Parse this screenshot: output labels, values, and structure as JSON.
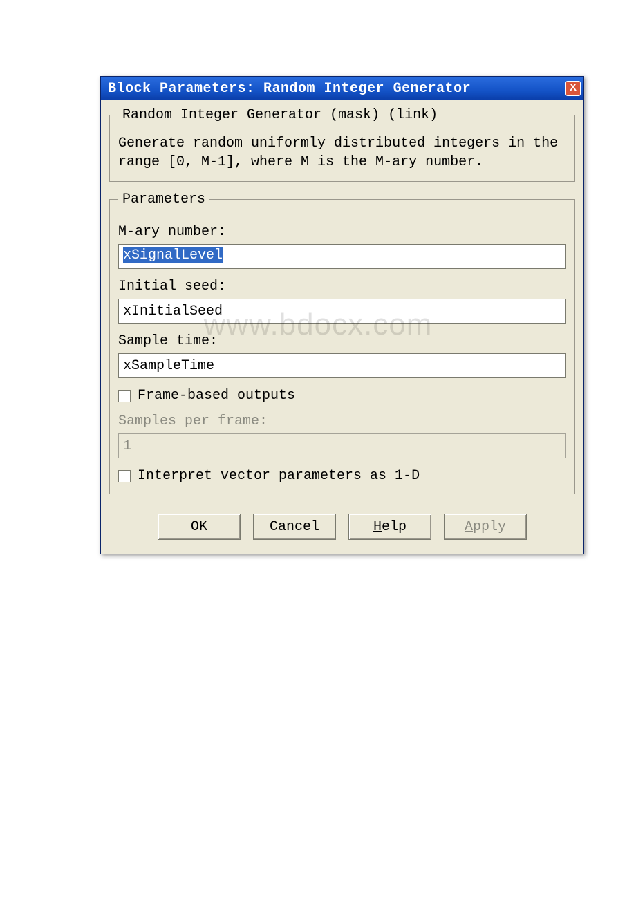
{
  "titlebar": {
    "title": "Block Parameters: Random Integer Generator",
    "close": "X"
  },
  "group_top": {
    "legend": "Random Integer Generator (mask) (link)",
    "description": "Generate random uniformly distributed integers in the range [0, M-1], where M is the M-ary number."
  },
  "params": {
    "legend": "Parameters",
    "mary_label": "M-ary number:",
    "mary_value": "xSignalLevel",
    "seed_label": "Initial seed:",
    "seed_value": "xInitialSeed",
    "sample_label": "Sample time:",
    "sample_value": "xSampleTime",
    "frame_based_label": "Frame-based outputs",
    "samples_per_frame_label": "Samples per frame:",
    "samples_per_frame_value": "1",
    "interpret_1d_label": "Interpret vector parameters as 1-D"
  },
  "buttons": {
    "ok": "OK",
    "cancel": "Cancel",
    "help_pre": "",
    "help_u": "H",
    "help_post": "elp",
    "apply_u": "A",
    "apply_post": "pply"
  },
  "watermark": "www.bdocx.com"
}
